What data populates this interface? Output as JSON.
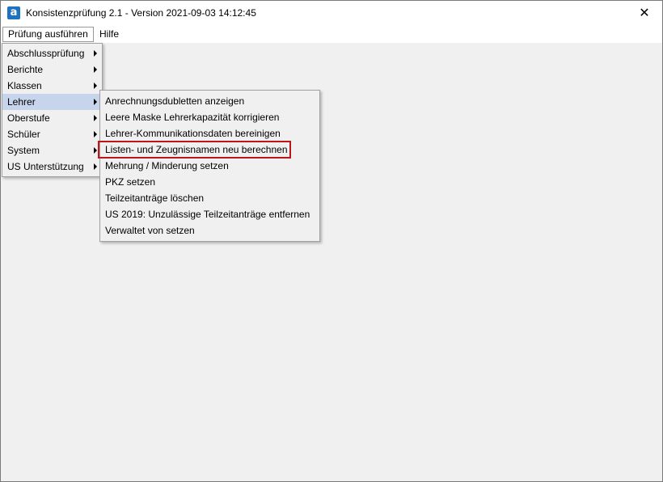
{
  "window": {
    "title": "Konsistenzprüfung 2.1 - Version 2021-09-03 14:12:45",
    "app_icon_letter": "a",
    "close_glyph": "✕"
  },
  "menubar": {
    "items": [
      {
        "label": "Prüfung ausführen",
        "open": true
      },
      {
        "label": "Hilfe",
        "open": false
      }
    ]
  },
  "main_menu": {
    "items": [
      {
        "label": "Abschlussprüfung",
        "has_submenu": true
      },
      {
        "label": "Berichte",
        "has_submenu": true
      },
      {
        "label": "Klassen",
        "has_submenu": true
      },
      {
        "label": "Lehrer",
        "has_submenu": true,
        "selected": true
      },
      {
        "label": "Oberstufe",
        "has_submenu": true
      },
      {
        "label": "Schüler",
        "has_submenu": true
      },
      {
        "label": "System",
        "has_submenu": true
      },
      {
        "label": "US Unterstützung",
        "has_submenu": true
      }
    ]
  },
  "lehrer_submenu": {
    "items": [
      {
        "label": "Anrechnungsdubletten anzeigen"
      },
      {
        "label": "Leere Maske Lehrerkapazität korrigieren"
      },
      {
        "label": "Lehrer-Kommunikationsdaten bereinigen"
      },
      {
        "label": "Listen- und Zeugnisnamen neu berechnen",
        "highlighted": true
      },
      {
        "label": "Mehrung / Minderung setzen"
      },
      {
        "label": "PKZ setzen"
      },
      {
        "label": "Teilzeitanträge löschen"
      },
      {
        "label": "US 2019: Unzulässige Teilzeitanträge entfernen"
      },
      {
        "label": "Verwaltet von setzen"
      }
    ]
  },
  "colors": {
    "selection": "#c7d5ec",
    "highlight_border": "#c0141b",
    "icon_bg": "#1e73be"
  }
}
